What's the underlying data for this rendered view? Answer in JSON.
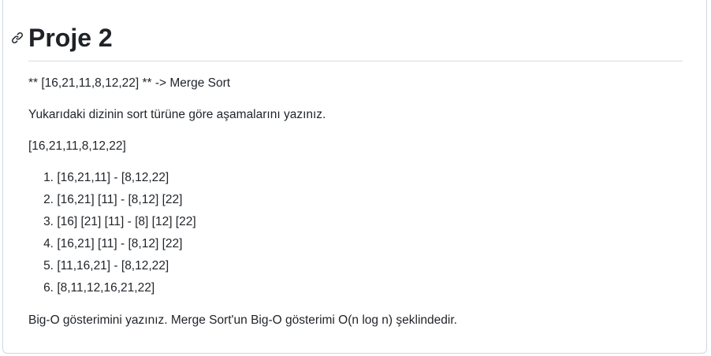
{
  "heading": {
    "title": "Proje 2",
    "anchor_icon": "link-icon"
  },
  "content": {
    "task_line": "** [16,21,11,8,12,22] ** -> Merge Sort",
    "instruction": "Yukarıdaki dizinin sort türüne göre aşamalarını yazınız.",
    "initial_array": "[16,21,11,8,12,22]",
    "steps": [
      {
        "num": "1.",
        "text": "[16,21,11] - [8,12,22]"
      },
      {
        "num": "2.",
        "text": "[16,21] [11] - [8,12] [22]"
      },
      {
        "num": "3.",
        "text": "[16] [21] [11] - [8] [12] [22]"
      },
      {
        "num": "4.",
        "text": "[16,21] [11] - [8,12] [22]"
      },
      {
        "num": "5.",
        "text": "[11,16,21] - [8,12,22]"
      },
      {
        "num": "6.",
        "text": "[8,11,12,16,21,22]"
      }
    ],
    "big_o": "Big-O gösterimini yazınız. Merge Sort'un Big-O gösterimi O(n log n) şeklindedir."
  },
  "colors": {
    "text": "#1f2328",
    "border": "#d0d7de",
    "divider": "#d8dee4"
  }
}
